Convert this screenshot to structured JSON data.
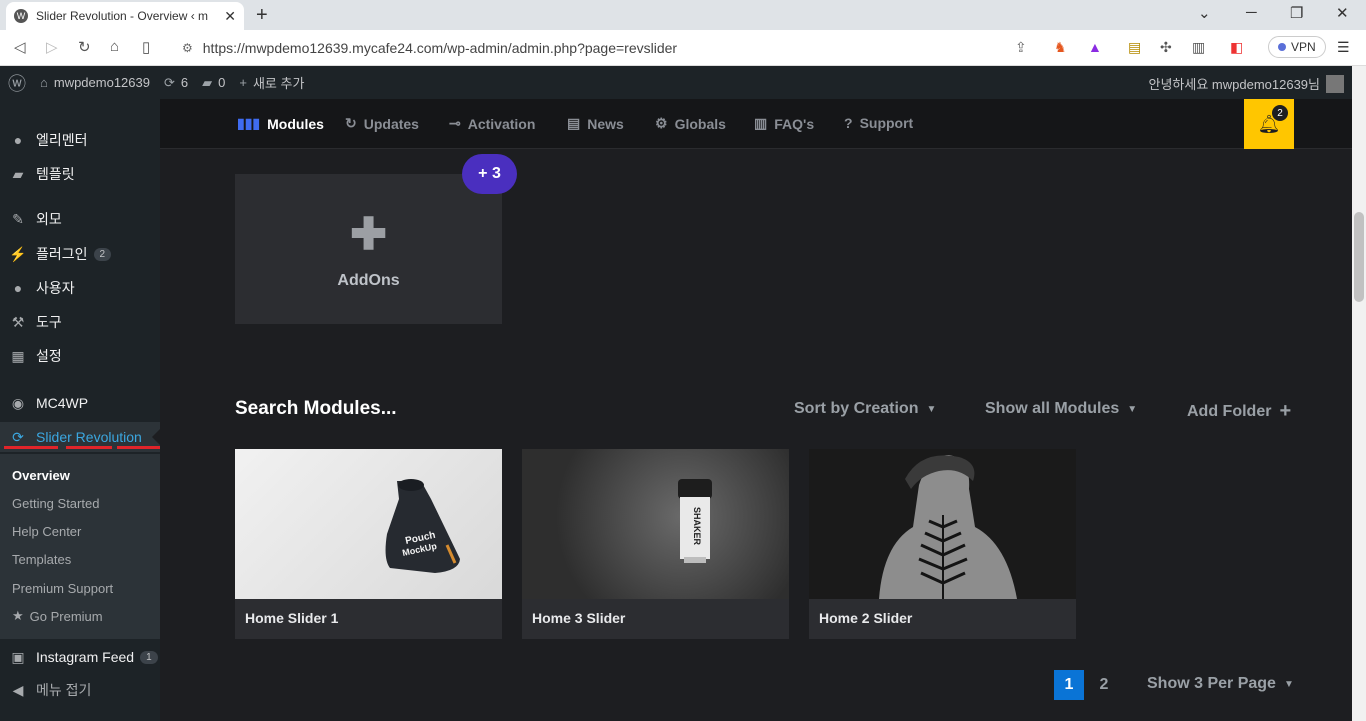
{
  "browser": {
    "tab_title": "Slider Revolution - Overview ‹ m",
    "url": "https://mwpdemo12639.mycafe24.com/wp-admin/admin.php?page=revslider",
    "vpn_label": "VPN"
  },
  "adminbar": {
    "site_name": "mwpdemo12639",
    "updates_count": "6",
    "comments_count": "0",
    "new_label": "새로 추가",
    "greeting": "안녕하세요 mwpdemo12639님"
  },
  "sidebar": {
    "items": [
      {
        "label": "엘리멘터",
        "icon": "elementor-icon"
      },
      {
        "label": "템플릿",
        "icon": "folder-icon"
      },
      {
        "label": "외모",
        "icon": "brush-icon"
      },
      {
        "label": "플러그인",
        "icon": "plugin-icon",
        "badge": "2"
      },
      {
        "label": "사용자",
        "icon": "user-icon"
      },
      {
        "label": "도구",
        "icon": "wrench-icon"
      },
      {
        "label": "설정",
        "icon": "settings-icon"
      },
      {
        "label": "MC4WP",
        "icon": "mc4wp-icon"
      },
      {
        "label": "Slider Revolution",
        "icon": "refresh-icon"
      },
      {
        "label": "Instagram Feed",
        "icon": "camera-icon",
        "badge": "1"
      },
      {
        "label": "메뉴 접기",
        "icon": "collapse-icon"
      }
    ],
    "submenu": [
      "Overview",
      "Getting Started",
      "Help Center",
      "Templates",
      "Premium Support",
      "Go Premium"
    ]
  },
  "topnav": {
    "items": [
      "Modules",
      "Updates",
      "Activation",
      "News",
      "Globals",
      "FAQ's",
      "Support"
    ],
    "bell_count": "2"
  },
  "addon": {
    "label": "AddOns",
    "badge": "+ 3"
  },
  "search": {
    "title": "Search Modules...",
    "sort_label": "Sort by Creation",
    "show_label": "Show all Modules",
    "add_folder_label": "Add Folder"
  },
  "modules": [
    {
      "name": "Home Slider 1"
    },
    {
      "name": "Home 3 Slider"
    },
    {
      "name": "Home 2 Slider"
    }
  ],
  "pagination": {
    "pages": [
      "1",
      "2"
    ],
    "per_page_label": "Show 3 Per Page"
  }
}
